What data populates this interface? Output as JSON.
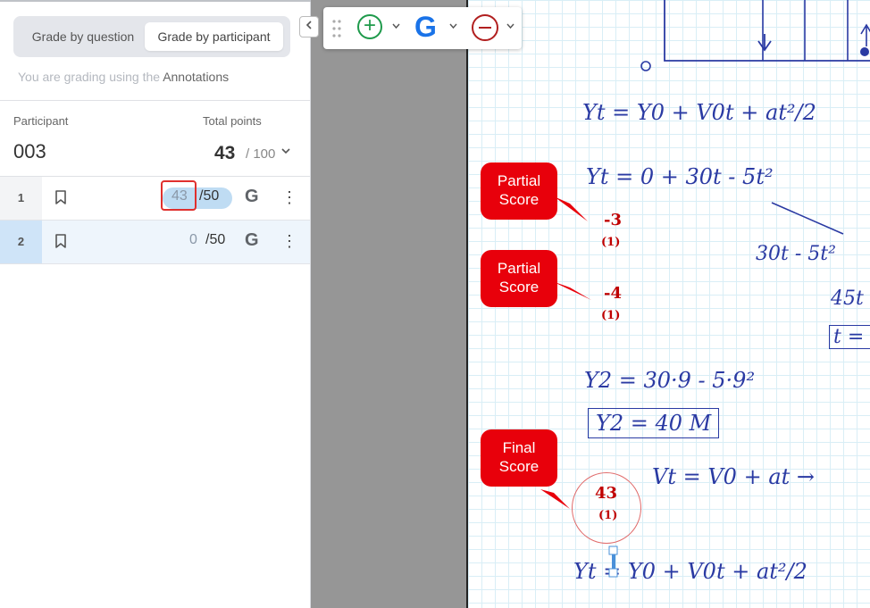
{
  "left_panel": {
    "grade_by_question": "Grade by question",
    "grade_by_participant": "Grade by participant",
    "grading_note_prefix": "You are grading using the",
    "grading_note_mode": "Annotations",
    "participant_label": "Participant",
    "total_points_label": "Total points",
    "participant_id": "003",
    "total_score": "43",
    "total_max": "/ 100",
    "questions": [
      {
        "number": "1",
        "score": "43",
        "max": "/50",
        "grader_icon": "G"
      },
      {
        "number": "2",
        "score": "0",
        "max": "/50",
        "grader_icon": "G"
      }
    ]
  },
  "toolbar": {
    "add_icon": "+",
    "grader_icon": "G"
  },
  "document": {
    "handwriting": [
      "Yt = Y0 + V0t + at²/2",
      "Yt = 0 + 30t - 5t²",
      "30t - 5t²",
      "45t",
      "t =",
      "Y2 = 30·9 - 5·9²",
      "Y2 = 40 M",
      "Vt = V0 + at →",
      "Yt = Y0 + V0t + at²/2"
    ],
    "annotations": [
      {
        "label_line1": "Partial",
        "label_line2": "Score",
        "value": "-3",
        "count": "(1)"
      },
      {
        "label_line1": "Partial",
        "label_line2": "Score",
        "value": "-4",
        "count": "(1)"
      },
      {
        "label_line1": "Final",
        "label_line2": "Score",
        "value": "43",
        "count": "(1)"
      }
    ]
  },
  "colors": {
    "accent_blue": "#1a73e8",
    "add_green": "#1e9a4b",
    "deduct_red": "#b11f1f",
    "callout_red": "#e8000b",
    "score_pill": "#bfdcf3"
  }
}
